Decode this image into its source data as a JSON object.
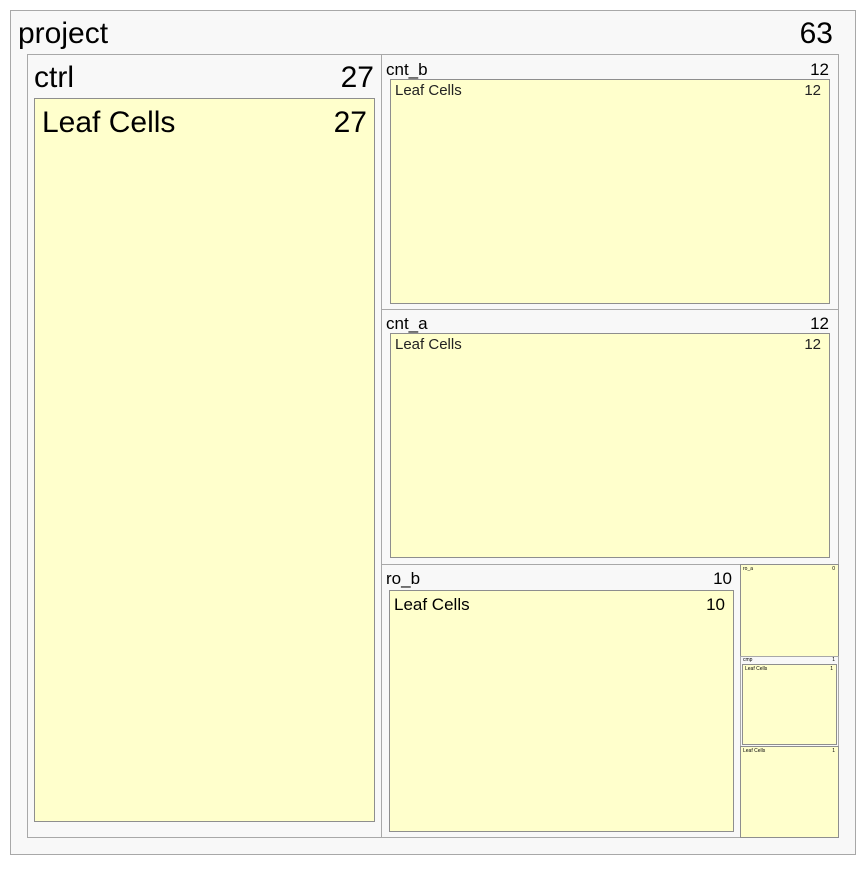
{
  "treemap": {
    "root": {
      "label": "project",
      "value": "63"
    },
    "ctrl": {
      "label": "ctrl",
      "value": "27",
      "leaf": {
        "label": "Leaf Cells",
        "value": "27"
      }
    },
    "cnt_b": {
      "label": "cnt_b",
      "value": "12",
      "leaf": {
        "label": "Leaf Cells",
        "value": "12"
      }
    },
    "cnt_a": {
      "label": "cnt_a",
      "value": "12",
      "leaf": {
        "label": "Leaf Cells",
        "value": "12"
      }
    },
    "ro_b": {
      "label": "ro_b",
      "value": "10",
      "leaf": {
        "label": "Leaf Cells",
        "value": "10"
      }
    },
    "ro_a": {
      "label": "ro_a",
      "value": "0"
    },
    "cmp": {
      "label": "cmp",
      "value": "1",
      "leaf": {
        "label": "Leaf Cells",
        "value": "1"
      }
    },
    "loose_leaf": {
      "label": "Leaf Cells",
      "value": "1"
    }
  },
  "colors": {
    "leaf_fill": "#ffffcc",
    "group_fill": "#f8f8f8",
    "border": "#a8a8a8"
  }
}
